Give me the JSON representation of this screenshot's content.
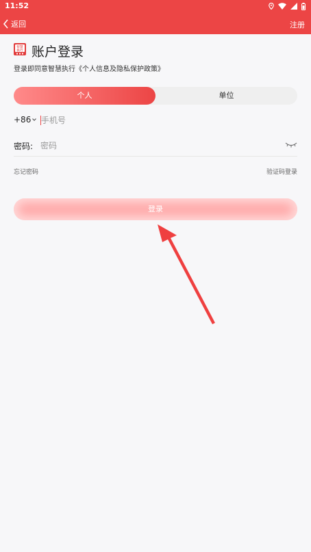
{
  "status": {
    "time": "11:52"
  },
  "nav": {
    "back_label": "返回",
    "register_label": "注册"
  },
  "logo": {
    "text_line1": "智慧",
    "text_line2": "执行"
  },
  "page": {
    "title": "账户登录",
    "agreement": "登录即同意智慧执行《个人信息及隐私保护政策》"
  },
  "tabs": [
    {
      "label": "个人",
      "active": true
    },
    {
      "label": "单位",
      "active": false
    }
  ],
  "phone": {
    "country_code": "+86",
    "placeholder": "手机号"
  },
  "password": {
    "label": "密码:",
    "placeholder": "密码"
  },
  "links": {
    "forgot": "忘记密码",
    "sms_login": "验证码登录"
  },
  "login_button": {
    "label": "登录"
  },
  "colors": {
    "primary": "#ec4545",
    "button_disabled": "#ffaaaa"
  }
}
